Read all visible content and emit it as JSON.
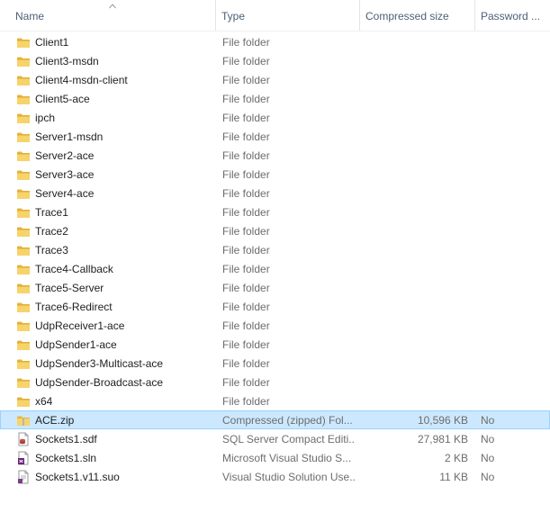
{
  "columns": {
    "name": "Name",
    "type": "Type",
    "compressed_size": "Compressed size",
    "password": "Password ..."
  },
  "sort": {
    "column": "name",
    "direction": "ascending",
    "icon": "sort-ascending-icon"
  },
  "colors": {
    "selection_fill": "#cce8ff",
    "selection_border": "#99d1ff",
    "header_text": "#4c607a",
    "secondary_text": "#6d6d6d",
    "folder_icon": "#f0c34a"
  },
  "files": [
    {
      "name": "Client1",
      "type": "File folder",
      "size": "",
      "password": "",
      "icon": "folder-icon"
    },
    {
      "name": "Client3-msdn",
      "type": "File folder",
      "size": "",
      "password": "",
      "icon": "folder-icon"
    },
    {
      "name": "Client4-msdn-client",
      "type": "File folder",
      "size": "",
      "password": "",
      "icon": "folder-icon"
    },
    {
      "name": "Client5-ace",
      "type": "File folder",
      "size": "",
      "password": "",
      "icon": "folder-icon"
    },
    {
      "name": "ipch",
      "type": "File folder",
      "size": "",
      "password": "",
      "icon": "folder-icon"
    },
    {
      "name": "Server1-msdn",
      "type": "File folder",
      "size": "",
      "password": "",
      "icon": "folder-icon"
    },
    {
      "name": "Server2-ace",
      "type": "File folder",
      "size": "",
      "password": "",
      "icon": "folder-icon"
    },
    {
      "name": "Server3-ace",
      "type": "File folder",
      "size": "",
      "password": "",
      "icon": "folder-icon"
    },
    {
      "name": "Server4-ace",
      "type": "File folder",
      "size": "",
      "password": "",
      "icon": "folder-icon"
    },
    {
      "name": "Trace1",
      "type": "File folder",
      "size": "",
      "password": "",
      "icon": "folder-icon"
    },
    {
      "name": "Trace2",
      "type": "File folder",
      "size": "",
      "password": "",
      "icon": "folder-icon"
    },
    {
      "name": "Trace3",
      "type": "File folder",
      "size": "",
      "password": "",
      "icon": "folder-icon"
    },
    {
      "name": "Trace4-Callback",
      "type": "File folder",
      "size": "",
      "password": "",
      "icon": "folder-icon"
    },
    {
      "name": "Trace5-Server",
      "type": "File folder",
      "size": "",
      "password": "",
      "icon": "folder-icon"
    },
    {
      "name": "Trace6-Redirect",
      "type": "File folder",
      "size": "",
      "password": "",
      "icon": "folder-icon"
    },
    {
      "name": "UdpReceiver1-ace",
      "type": "File folder",
      "size": "",
      "password": "",
      "icon": "folder-icon"
    },
    {
      "name": "UdpSender1-ace",
      "type": "File folder",
      "size": "",
      "password": "",
      "icon": "folder-icon"
    },
    {
      "name": "UdpSender3-Multicast-ace",
      "type": "File folder",
      "size": "",
      "password": "",
      "icon": "folder-icon"
    },
    {
      "name": "UdpSender-Broadcast-ace",
      "type": "File folder",
      "size": "",
      "password": "",
      "icon": "folder-icon"
    },
    {
      "name": "x64",
      "type": "File folder",
      "size": "",
      "password": "",
      "icon": "folder-icon"
    },
    {
      "name": "ACE.zip",
      "type": "Compressed (zipped) Fol...",
      "size": "10,596 KB",
      "password": "No",
      "icon": "zip-folder-icon",
      "selected": true
    },
    {
      "name": "Sockets1.sdf",
      "type": "SQL Server Compact Editi...",
      "size": "27,981 KB",
      "password": "No",
      "icon": "sdf-file-icon"
    },
    {
      "name": "Sockets1.sln",
      "type": "Microsoft Visual Studio S...",
      "size": "2 KB",
      "password": "No",
      "icon": "sln-file-icon"
    },
    {
      "name": "Sockets1.v11.suo",
      "type": "Visual Studio Solution Use...",
      "size": "11 KB",
      "password": "No",
      "icon": "suo-file-icon"
    }
  ]
}
